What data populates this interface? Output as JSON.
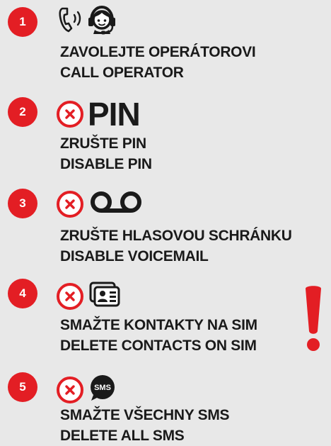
{
  "steps": [
    {
      "number": "1",
      "line1": "ZAVOLEJTE OPERÁTOROVI",
      "line2": "CALL OPERATOR",
      "icons": [
        "phone-ringing-icon",
        "operator-headset-icon"
      ]
    },
    {
      "number": "2",
      "line1": "ZRUŠTE PIN",
      "line2": "DISABLE PIN",
      "icon_text": "PIN",
      "icons": [
        "cancel-icon",
        "pin-text"
      ]
    },
    {
      "number": "3",
      "line1": "ZRUŠTE HLASOVOU SCHRÁNKU",
      "line2": "DISABLE VOICEMAIL",
      "icons": [
        "cancel-icon",
        "voicemail-icon"
      ]
    },
    {
      "number": "4",
      "line1": "SMAŽTE KONTAKTY NA SIM",
      "line2": "DELETE CONTACTS ON SIM",
      "icons": [
        "cancel-icon",
        "contact-cards-icon"
      ]
    },
    {
      "number": "5",
      "line1": "SMAŽTE VŠECHNY SMS",
      "line2": "DELETE ALL SMS",
      "icon_text": "SMS",
      "icons": [
        "cancel-icon",
        "sms-bubble-icon"
      ]
    }
  ],
  "warning_icon": "exclamation-icon",
  "colors": {
    "accent": "#e31e24",
    "text": "#1a1a1a",
    "background": "#e8e8e8"
  }
}
